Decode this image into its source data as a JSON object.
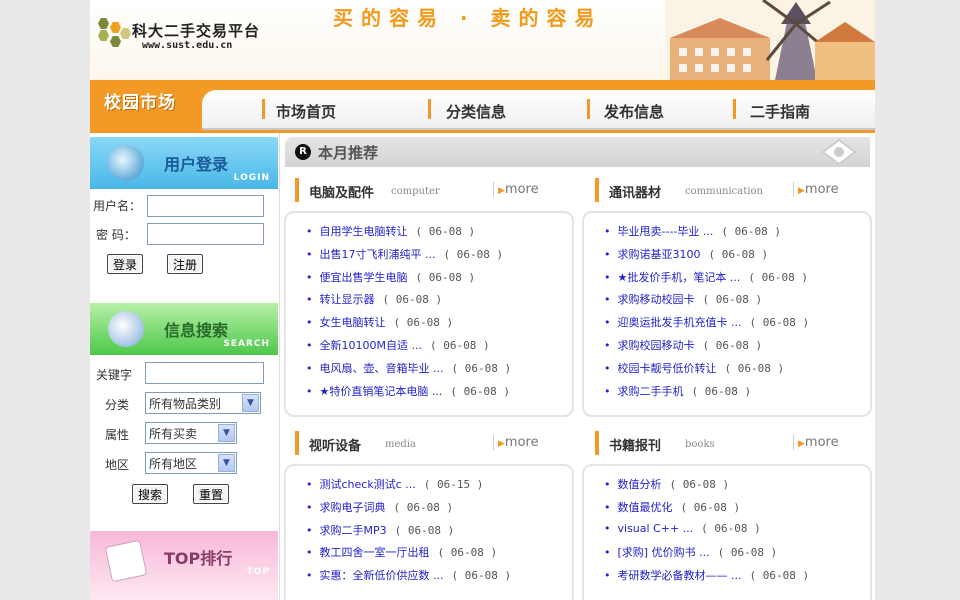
{
  "header": {
    "logo_title": "科大二手交易平台",
    "logo_url": "www.sust.edu.cn",
    "slogan": "买的容易 · 卖的容易"
  },
  "nav": {
    "site_label": "校园市场",
    "items": [
      "市场首页",
      "分类信息",
      "发布信息",
      "二手指南"
    ]
  },
  "login": {
    "title": "用户登录",
    "subtitle": "LOGIN",
    "username_label": "用户名：",
    "password_label": "密 码：",
    "username_value": "",
    "password_value": "",
    "login_button": "登录",
    "register_button": "注册"
  },
  "search": {
    "title": "信息搜索",
    "subtitle": "SEARCH",
    "keyword_label": "关键字",
    "keyword_value": "",
    "category_label": "分类",
    "category_value": "所有物品类别",
    "property_label": "属性",
    "property_value": "所有买卖",
    "region_label": "地区",
    "region_value": "所有地区",
    "search_button": "搜索",
    "reset_button": "重置"
  },
  "top": {
    "title": "TOP排行",
    "subtitle": "TOP"
  },
  "recommend": {
    "title": "本月推荐",
    "icon_letter": "R"
  },
  "boxes": [
    {
      "name": "电脑及配件",
      "en": "computer",
      "more": "more",
      "items": [
        {
          "title": "自用学生电脑转让",
          "date": "( 06-08 )"
        },
        {
          "title": "出售17寸飞利浦纯平 ...",
          "date": "( 06-08 )"
        },
        {
          "title": "便宜出售学生电脑",
          "date": "( 06-08 )"
        },
        {
          "title": "转让显示器",
          "date": "( 06-08 )"
        },
        {
          "title": "女生电脑转让",
          "date": "( 06-08 )"
        },
        {
          "title": "全新10100M自适 ...",
          "date": "( 06-08 )"
        },
        {
          "title": "电风扇、壶、音箱毕业 ...",
          "date": "( 06-08 )"
        },
        {
          "title": "★特价直销笔记本电脑 ...",
          "date": "( 06-08 )"
        }
      ]
    },
    {
      "name": "通讯器材",
      "en": "communication",
      "more": "more",
      "items": [
        {
          "title": "毕业甩卖----毕业 ...",
          "date": "( 06-08 )"
        },
        {
          "title": "求购诺基亚3100",
          "date": "( 06-08 )"
        },
        {
          "title": "★批发价手机，笔记本 ...",
          "date": "( 06-08 )"
        },
        {
          "title": "求购移动校园卡",
          "date": "( 06-08 )"
        },
        {
          "title": "迎奥运批发手机充值卡 ...",
          "date": "( 06-08 )"
        },
        {
          "title": "求购校园移动卡",
          "date": "( 06-08 )"
        },
        {
          "title": "校园卡靓号低价转让",
          "date": "( 06-08 )"
        },
        {
          "title": "求购二手手机",
          "date": "( 06-08 )"
        }
      ]
    },
    {
      "name": "视听设备",
      "en": "media",
      "more": "more",
      "items": [
        {
          "title": "测试check测试c ...",
          "date": "( 06-15 )"
        },
        {
          "title": "求购电子词典",
          "date": "( 06-08 )"
        },
        {
          "title": "求购二手MP3",
          "date": "( 06-08 )"
        },
        {
          "title": "教工四舍一室一厅出租",
          "date": "( 06-08 )"
        },
        {
          "title": "实惠：全新低价供应数 ...",
          "date": "( 06-08 )"
        }
      ]
    },
    {
      "name": "书籍报刊",
      "en": "books",
      "more": "more",
      "items": [
        {
          "title": "数值分析",
          "date": "( 06-08 )"
        },
        {
          "title": "数值最优化",
          "date": "( 06-08 )"
        },
        {
          "title": "visual C++ ...",
          "date": "( 06-08 )"
        },
        {
          "title": "[求购] 优价购书 ...",
          "date": "( 06-08 )"
        },
        {
          "title": "考研数学必备教材—— ...",
          "date": "( 06-08 )"
        }
      ]
    }
  ],
  "colors": {
    "accent": "#f39a26",
    "link": "#2222cc",
    "login_bg": "#5cc8f0",
    "search_bg": "#6cd068",
    "top_bg": "#f6a8d0"
  }
}
